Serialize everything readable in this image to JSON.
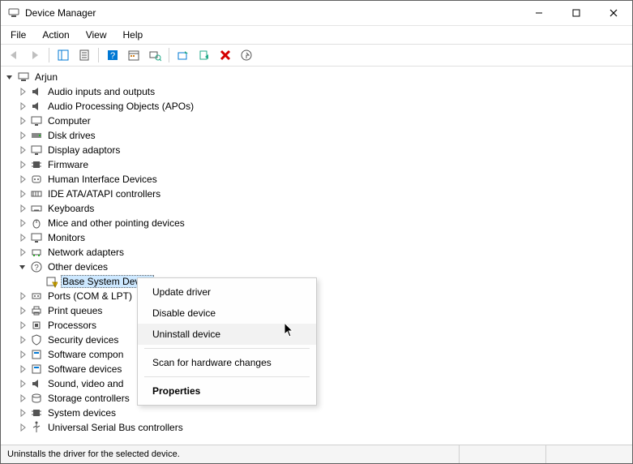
{
  "window": {
    "title": "Device Manager"
  },
  "menubar": {
    "items": [
      "File",
      "Action",
      "View",
      "Help"
    ]
  },
  "toolbar": {
    "buttons": [
      {
        "name": "back-icon",
        "interactable": false,
        "kind": "back"
      },
      {
        "name": "forward-icon",
        "interactable": false,
        "kind": "forward"
      },
      {
        "sep": true
      },
      {
        "name": "show-hide-tree-icon",
        "interactable": true,
        "kind": "showtree"
      },
      {
        "name": "properties-icon",
        "interactable": true,
        "kind": "propsheet"
      },
      {
        "sep": true
      },
      {
        "name": "help-icon",
        "interactable": true,
        "kind": "help"
      },
      {
        "name": "calendar-icon",
        "interactable": true,
        "kind": "calendar"
      },
      {
        "name": "scan-hardware-icon",
        "interactable": true,
        "kind": "scanhw"
      },
      {
        "sep": true
      },
      {
        "name": "update-driver-icon",
        "interactable": true,
        "kind": "upddrv"
      },
      {
        "name": "enable-device-icon",
        "interactable": true,
        "kind": "enable"
      },
      {
        "name": "uninstall-icon",
        "interactable": true,
        "kind": "uninstall"
      },
      {
        "name": "add-legacy-icon",
        "interactable": true,
        "kind": "addlegacy"
      }
    ]
  },
  "tree": {
    "root": {
      "label": "Arjun",
      "icon": "computer-icon",
      "expanded": true
    },
    "categories": [
      {
        "label": "Audio inputs and outputs",
        "icon": "speaker-icon",
        "expand": "col"
      },
      {
        "label": "Audio Processing Objects (APOs)",
        "icon": "speaker-icon",
        "expand": "col"
      },
      {
        "label": "Computer",
        "icon": "monitor-icon",
        "expand": "col"
      },
      {
        "label": "Disk drives",
        "icon": "disk-icon",
        "expand": "col"
      },
      {
        "label": "Display adaptors",
        "icon": "monitor-icon",
        "expand": "col"
      },
      {
        "label": "Firmware",
        "icon": "chip-icon",
        "expand": "col"
      },
      {
        "label": "Human Interface Devices",
        "icon": "hid-icon",
        "expand": "col"
      },
      {
        "label": "IDE ATA/ATAPI controllers",
        "icon": "ide-icon",
        "expand": "col"
      },
      {
        "label": "Keyboards",
        "icon": "keyboard-icon",
        "expand": "col"
      },
      {
        "label": "Mice and other pointing devices",
        "icon": "mouse-icon",
        "expand": "col"
      },
      {
        "label": "Monitors",
        "icon": "monitor-icon",
        "expand": "col"
      },
      {
        "label": "Network adapters",
        "icon": "network-icon",
        "expand": "col"
      },
      {
        "label": "Other devices",
        "icon": "other-icon",
        "expand": "exp",
        "children": [
          {
            "label": "Base System Device",
            "icon": "unknown-device-icon",
            "selected": true
          }
        ]
      },
      {
        "label": "Ports (COM & LPT)",
        "icon": "port-icon",
        "expand": "col",
        "truncated": true
      },
      {
        "label": "Print queues",
        "icon": "printer-icon",
        "expand": "col"
      },
      {
        "label": "Processors",
        "icon": "cpu-icon",
        "expand": "col"
      },
      {
        "label": "Security devices",
        "icon": "security-icon",
        "expand": "col"
      },
      {
        "label": "Software components",
        "icon": "software-icon",
        "expand": "col",
        "truncated": true,
        "trunc_label": "Software compon"
      },
      {
        "label": "Software devices",
        "icon": "software-icon",
        "expand": "col"
      },
      {
        "label": "Sound, video and game controllers",
        "icon": "speaker-icon",
        "expand": "col",
        "truncated": true,
        "trunc_label": "Sound, video and"
      },
      {
        "label": "Storage controllers",
        "icon": "storage-icon",
        "expand": "col"
      },
      {
        "label": "System devices",
        "icon": "chip-icon",
        "expand": "col"
      },
      {
        "label": "Universal Serial Bus controllers",
        "icon": "usb-icon",
        "expand": "col"
      }
    ]
  },
  "context_menu": {
    "items": [
      {
        "label": "Update driver",
        "name": "cm-update-driver"
      },
      {
        "label": "Disable device",
        "name": "cm-disable-device"
      },
      {
        "label": "Uninstall device",
        "name": "cm-uninstall-device",
        "hover": true
      },
      {
        "sep": true
      },
      {
        "label": "Scan for hardware changes",
        "name": "cm-scan-hardware"
      },
      {
        "sep": true
      },
      {
        "label": "Properties",
        "name": "cm-properties",
        "bold": true
      }
    ]
  },
  "statusbar": {
    "text": "Uninstalls the driver for the selected device."
  }
}
